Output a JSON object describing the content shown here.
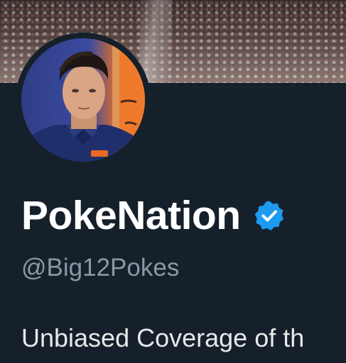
{
  "profile": {
    "display_name": "PokeNation",
    "handle": "@Big12Pokes",
    "bio": "Unbiased Coverage of th",
    "verified": true
  },
  "icons": {
    "verified": "verified-badge-icon"
  },
  "colors": {
    "background": "#15202b",
    "name": "#ffffff",
    "handle": "#8b98a5",
    "bio": "#e7e9ea",
    "verified": "#1d9bf0"
  }
}
